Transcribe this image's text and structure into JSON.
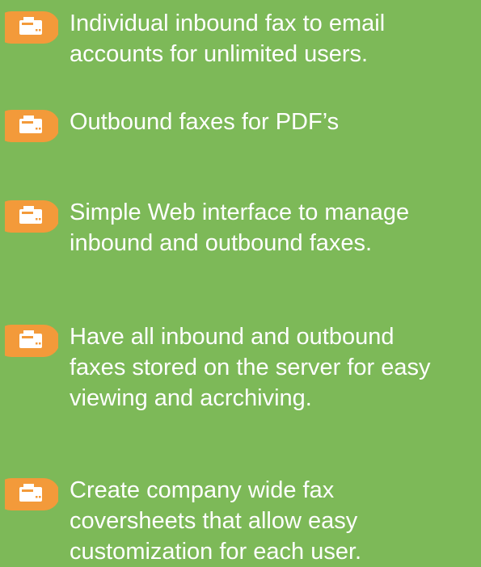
{
  "colors": {
    "background": "#7db958",
    "badge_orange": "#f39a3a",
    "text": "#ffffff"
  },
  "features": [
    {
      "icon": "fax-icon",
      "text": "Individual inbound fax to email\naccounts for unlimited users."
    },
    {
      "icon": "fax-icon",
      "text": "Outbound faxes for PDF’s"
    },
    {
      "icon": "fax-icon",
      "text": "Simple Web interface to manage\ninbound and outbound faxes."
    },
    {
      "icon": "fax-icon",
      "text": "Have all inbound and outbound\nfaxes stored on the server for easy\nviewing and acrchiving."
    },
    {
      "icon": "fax-icon",
      "text": "Create company wide fax\ncoversheets that allow easy\ncustomization for each user."
    }
  ]
}
